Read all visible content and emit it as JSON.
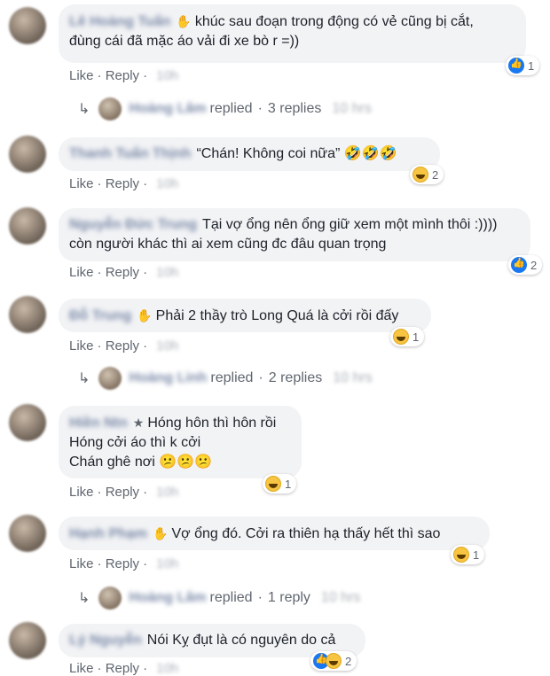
{
  "comments": [
    {
      "name": "Lê Hoàng Tuấn",
      "lines": [
        "khúc sau đoạn trong động có vẻ cũng bị cắt,",
        "đùng cái đã mặc áo vải đi xe bò r =))"
      ],
      "like": "Like",
      "reply": "Reply",
      "time": "10h",
      "reaction_count": "1",
      "reaction_type": "like",
      "replies": {
        "name": "Hoàng Lâm",
        "text": "replied",
        "count": "3 replies",
        "time": "10 hrs"
      }
    },
    {
      "name": "Thanh Tuấn Thịnh",
      "lines": [
        "“Chán! Không coi nữa” 🤣🤣🤣"
      ],
      "like": "Like",
      "reply": "Reply",
      "time": "10h",
      "reaction_count": "2",
      "reaction_type": "haha"
    },
    {
      "name": "Nguyễn Đức Trung",
      "lines": [
        "Tại vợ ổng nên ổng giữ xem một mình thôi :))))",
        "còn người khác thì ai xem cũng đc đâu quan trọng"
      ],
      "like": "Like",
      "reply": "Reply",
      "time": "10h",
      "reaction_count": "2",
      "reaction_type": "like"
    },
    {
      "name": "Đỗ Trung",
      "lines": [
        "Phải 2 thầy trò Long Quá là cởi rồi đấy"
      ],
      "like": "Like",
      "reply": "Reply",
      "time": "10h",
      "reaction_count": "1",
      "reaction_type": "haha",
      "replies": {
        "name": "Hoàng Linh",
        "text": "replied",
        "count": "2 replies",
        "time": "10 hrs"
      }
    },
    {
      "name": "Hiền Ntn",
      "lines": [
        "Hóng hôn thì hôn rồi",
        "Hóng cởi áo thì k cởi",
        "Chán ghê nơi 😕😕😕"
      ],
      "like": "Like",
      "reply": "Reply",
      "time": "10h",
      "reaction_count": "1",
      "reaction_type": "haha"
    },
    {
      "name": "Hạnh Phạm",
      "lines": [
        "Vợ ổng đó. Cởi ra thiên hạ thấy hết thì sao"
      ],
      "like": "Like",
      "reply": "Reply",
      "time": "10h",
      "reaction_count": "1",
      "reaction_type": "haha",
      "replies": {
        "name": "Hoàng Lâm",
        "text": "replied",
        "count": "1 reply",
        "time": "10 hrs"
      }
    },
    {
      "name": "Lý Nguyễn",
      "lines": [
        "Nói Kỵ đụt là có nguyên do cả"
      ],
      "like": "Like",
      "reply": "Reply",
      "time": "10h",
      "reaction_count": "2",
      "reaction_type": "like+haha"
    }
  ]
}
